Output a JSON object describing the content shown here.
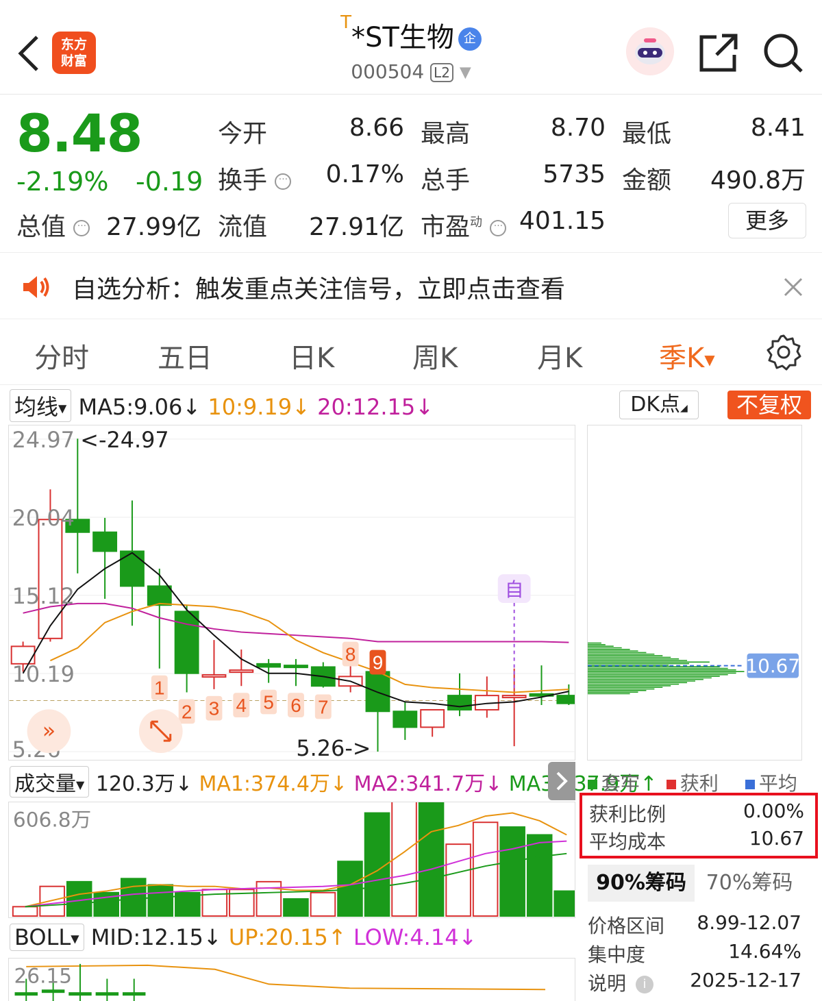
{
  "header": {
    "logo_line1": "东方",
    "logo_line2": "财富",
    "title_prefix": "T",
    "title": "*ST生物",
    "title_badge": "企",
    "code": "000504",
    "level": "L2"
  },
  "quote": {
    "price": "8.48",
    "change_pct": "-2.19%",
    "change": "-0.19",
    "rows": [
      [
        {
          "label": "今开",
          "value": "8.66",
          "color": "g"
        },
        {
          "label": "最高",
          "value": "8.70",
          "color": "r"
        },
        {
          "label": "最低",
          "value": "8.41",
          "color": "g"
        }
      ],
      [
        {
          "label": "换手",
          "value": "0.17%",
          "color": ""
        },
        {
          "label": "总手",
          "value": "5735",
          "color": ""
        },
        {
          "label": "金额",
          "value": "490.8万",
          "color": ""
        }
      ]
    ],
    "total_value_label": "总值",
    "total_value": "27.99亿",
    "float_value_label": "流值",
    "float_value": "27.91亿",
    "pe_label": "市盈",
    "pe_sup": "动",
    "pe_value": "401.15",
    "more_label": "更多"
  },
  "notice": {
    "text": "自选分析：触发重点关注信号，立即点击查看"
  },
  "tabs": [
    "分时",
    "五日",
    "日K",
    "周K",
    "月K",
    "季K"
  ],
  "active_tab": "季K",
  "indicator": {
    "ma_selector": "均线",
    "ma5": "MA5:9.06",
    "ma10": "10:9.19",
    "ma20": "20:12.15",
    "dk_label": "DK点",
    "fuquan_label": "不复权"
  },
  "chart_data": [
    {
      "type": "candlestick",
      "ylim": [
        5.26,
        24.97
      ],
      "y_ticks": [
        "24.97",
        "20.04",
        "15.12",
        "10.19",
        "5.26"
      ],
      "max_label": "<-24.97",
      "min_label": "5.26->",
      "candles": [
        {
          "o": 10.8,
          "c": 11.9,
          "h": 12.2,
          "l": 10.3
        },
        {
          "o": 12.4,
          "c": 19.9,
          "h": 21.8,
          "l": 12.2
        },
        {
          "o": 19.9,
          "c": 19.1,
          "h": 25.0,
          "l": 16.5
        },
        {
          "o": 19.1,
          "c": 17.9,
          "h": 20.0,
          "l": 14.9
        },
        {
          "o": 17.9,
          "c": 15.7,
          "h": 21.1,
          "l": 13.2
        },
        {
          "o": 15.7,
          "c": 14.5,
          "h": 16.8,
          "l": 10.5
        },
        {
          "o": 14.1,
          "c": 10.2,
          "h": 14.5,
          "l": 9.0
        },
        {
          "o": 10.1,
          "c": 10.1,
          "h": 12.3,
          "l": 9.2
        },
        {
          "o": 10.3,
          "c": 10.4,
          "h": 11.7,
          "l": 9.4
        },
        {
          "o": 10.8,
          "c": 10.6,
          "h": 11.1,
          "l": 9.6
        },
        {
          "o": 10.7,
          "c": 10.6,
          "h": 11.1,
          "l": 9.4
        },
        {
          "o": 10.6,
          "c": 9.4,
          "h": 10.9,
          "l": 9.3
        },
        {
          "o": 9.4,
          "c": 10.0,
          "h": 10.9,
          "l": 9.0
        },
        {
          "o": 10.3,
          "c": 7.8,
          "h": 10.9,
          "l": 5.26
        },
        {
          "o": 7.8,
          "c": 6.8,
          "h": 8.4,
          "l": 6.0
        },
        {
          "o": 6.8,
          "c": 7.9,
          "h": 7.9,
          "l": 6.2
        },
        {
          "o": 8.8,
          "c": 7.9,
          "h": 10.2,
          "l": 7.5
        },
        {
          "o": 7.9,
          "c": 8.8,
          "h": 10.0,
          "l": 7.4
        },
        {
          "o": 8.8,
          "c": 8.8,
          "h": 10.5,
          "l": 5.6
        },
        {
          "o": 8.9,
          "c": 8.8,
          "h": 10.7,
          "l": 8.2
        },
        {
          "o": 8.8,
          "c": 8.3,
          "h": 9.5,
          "l": 8.2
        }
      ],
      "ma5": [
        10.2,
        13.2,
        15.5,
        16.8,
        17.8,
        16.4,
        14.2,
        12.6,
        11.1,
        10.2,
        10.2,
        10.0,
        9.7,
        9.0,
        8.4,
        8.3,
        8.1,
        8.3,
        8.4,
        8.7,
        9.06
      ],
      "ma10": [
        null,
        11.0,
        11.8,
        13.4,
        14.1,
        14.6,
        14.5,
        14.4,
        14.1,
        13.5,
        12.3,
        11.5,
        10.9,
        10.3,
        9.5,
        9.3,
        9.2,
        9.1,
        9.0,
        9.1,
        9.19
      ],
      "ma20": [
        14.0,
        14.4,
        14.6,
        14.6,
        14.3,
        13.7,
        13.3,
        13.0,
        12.8,
        12.7,
        12.6,
        12.5,
        12.4,
        12.2,
        12.2,
        12.2,
        12.2,
        12.2,
        12.2,
        12.2,
        12.15
      ],
      "signals": [
        {
          "i": 5,
          "n": "1"
        },
        {
          "i": 6,
          "n": "2"
        },
        {
          "i": 7,
          "n": "3"
        },
        {
          "i": 8,
          "n": "4"
        },
        {
          "i": 9,
          "n": "5"
        },
        {
          "i": 10,
          "n": "6"
        },
        {
          "i": 11,
          "n": "7"
        },
        {
          "i": 12,
          "n": "8"
        },
        {
          "i": 13,
          "n": "9"
        }
      ],
      "zi_marker": "自"
    },
    {
      "type": "bar",
      "title": "成交量",
      "ylim": [
        0,
        606.8
      ],
      "y_top_label": "606.8万",
      "values": [
        60,
        190,
        220,
        150,
        240,
        200,
        150,
        170,
        170,
        220,
        110,
        150,
        350,
        660,
        810,
        870,
        460,
        600,
        570,
        520,
        160
      ],
      "up": [
        true,
        true,
        false,
        false,
        false,
        false,
        false,
        true,
        true,
        true,
        false,
        true,
        false,
        false,
        true,
        false,
        true,
        true,
        false,
        false,
        false
      ],
      "ma1": [
        60,
        100,
        140,
        160,
        190,
        200,
        190,
        190,
        175,
        180,
        165,
        165,
        200,
        290,
        410,
        540,
        580,
        640,
        660,
        610,
        520
      ],
      "ma2": [
        60,
        80,
        100,
        120,
        140,
        150,
        160,
        170,
        175,
        180,
        185,
        190,
        200,
        230,
        260,
        300,
        350,
        400,
        430,
        470,
        480
      ],
      "ma3": [
        60,
        70,
        80,
        95,
        110,
        120,
        130,
        140,
        145,
        150,
        155,
        160,
        170,
        185,
        210,
        240,
        280,
        320,
        350,
        380,
        400
      ]
    }
  ],
  "volume": {
    "selector": "成交量",
    "value": "120.3万",
    "ma1": "MA1:374.4万",
    "ma2": "MA2:341.7万",
    "ma3": "MA3:237.9万"
  },
  "boll": {
    "selector": "BOLL",
    "mid": "MID:12.15",
    "up": "UP:20.15",
    "low": "LOW:4.14",
    "top_label": "26.15"
  },
  "chip": {
    "avg_label": "10.67",
    "legend": [
      "套牢",
      "获利",
      "平均"
    ],
    "legend_colors": [
      "#22a022",
      "#e03030",
      "#3a6fd8"
    ],
    "profit_ratio_label": "获利比例",
    "profit_ratio": "0.00%",
    "avg_cost_label": "平均成本",
    "avg_cost": "10.67",
    "tab90": "90%筹码",
    "tab70": "70%筹码",
    "price_range_label": "价格区间",
    "price_range": "8.99-12.07",
    "concentration_label": "集中度",
    "concentration": "14.64%",
    "note_label": "说明",
    "date": "2025-12-17"
  }
}
